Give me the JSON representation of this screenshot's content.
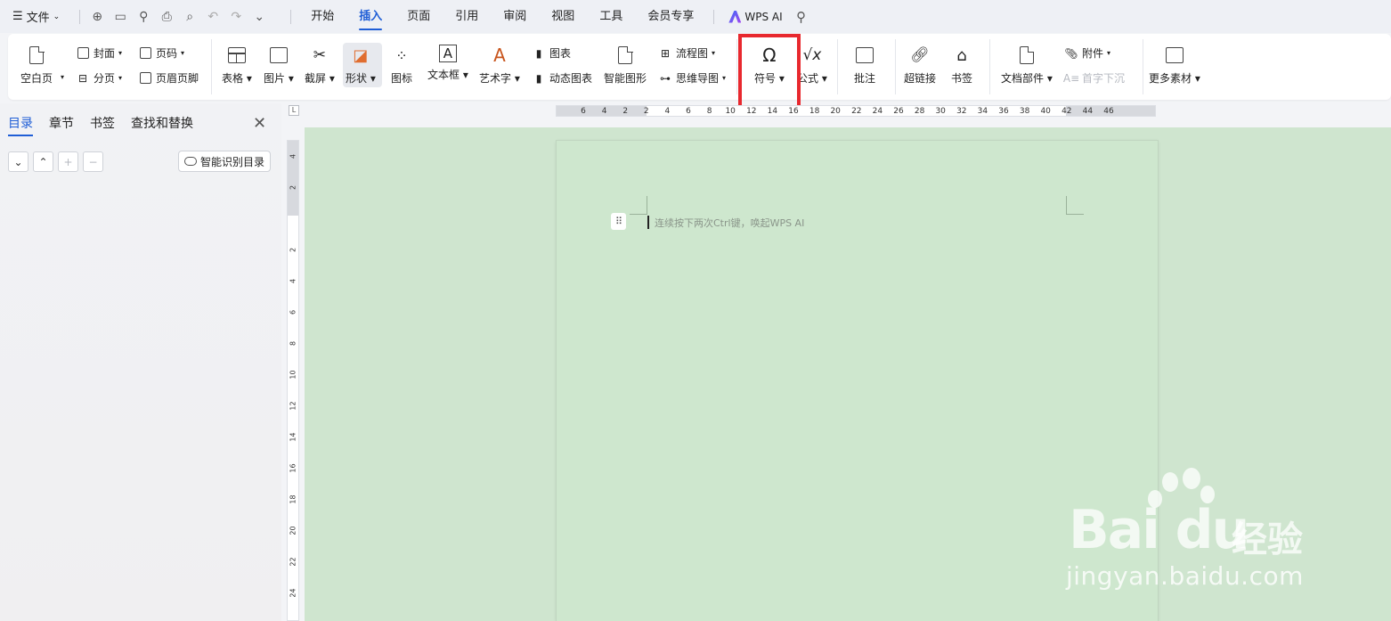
{
  "menubar": {
    "file_label": "文件",
    "tabs": [
      "开始",
      "插入",
      "页面",
      "引用",
      "审阅",
      "视图",
      "工具",
      "会员专享"
    ],
    "active_tab": "插入",
    "wps_ai_label": "WPS AI"
  },
  "ribbon": {
    "blank_page": "空白页",
    "cover": "封面",
    "page_break": "分页",
    "page_number": "页码",
    "header_footer": "页眉页脚",
    "table": "表格",
    "picture": "图片",
    "screenshot": "截屏",
    "shape": "形状",
    "icon": "图标",
    "textbox": "文本框",
    "wordart": "艺术字",
    "chart": "图表",
    "dynamic_chart": "动态图表",
    "smart_graphic": "智能图形",
    "flowchart": "流程图",
    "mindmap": "思维导图",
    "symbol": "符号",
    "formula": "公式",
    "comment": "批注",
    "hyperlink": "超链接",
    "bookmark": "书签",
    "doc_parts": "文档部件",
    "attachment": "附件",
    "drop_cap": "首字下沉",
    "more_assets": "更多素材",
    "highlight_color": "#e8282e"
  },
  "ruler": {
    "h_ticks": [
      "6",
      "4",
      "2",
      "2",
      "4",
      "6",
      "8",
      "10",
      "12",
      "14",
      "16",
      "18",
      "20",
      "22",
      "24",
      "26",
      "28",
      "30",
      "32",
      "34",
      "36",
      "38",
      "40",
      "42",
      "44",
      "46"
    ],
    "v_ticks": [
      "4",
      "2",
      "2",
      "4",
      "6",
      "8",
      "10",
      "12",
      "14",
      "16",
      "18",
      "20",
      "22",
      "24"
    ],
    "corner": "L"
  },
  "nav": {
    "tabs": [
      "目录",
      "章节",
      "书签",
      "查找和替换"
    ],
    "active_tab": "目录",
    "smart_toc_label": "智能识别目录"
  },
  "document": {
    "hint_text": "连续按下两次Ctrl键，唤起WPS AI",
    "page_color": "#cee7ce"
  },
  "watermark": {
    "brand": "Bai du",
    "brand_cn": "经验",
    "url": "jingyan.baidu.com"
  }
}
